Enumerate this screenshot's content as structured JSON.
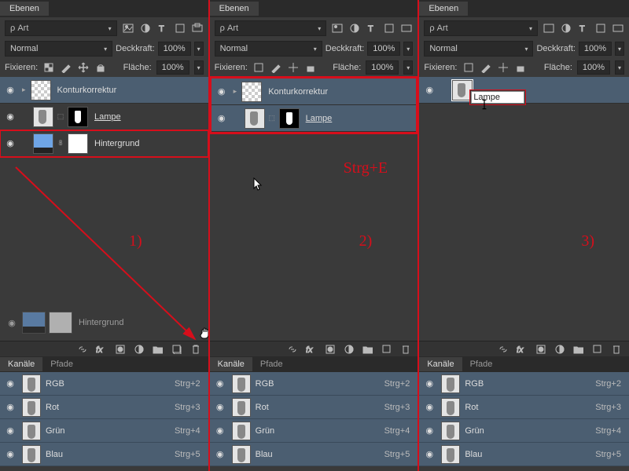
{
  "panel_title": "Ebenen",
  "filter_label": "Art",
  "blend_mode": "Normal",
  "opacity_label": "Deckkraft:",
  "opacity_value": "100%",
  "fix_label": "Fixieren:",
  "fill_label": "Fläche:",
  "fill_value": "100%",
  "layers": {
    "kontur": "Konturkorrektur",
    "lampe": "Lampe",
    "lampe_u": "Lampe ",
    "hintergrund": "Hintergrund"
  },
  "rename_value": "Lampe",
  "channels_tab": "Kanäle",
  "paths_tab": "Pfade",
  "channels": [
    {
      "name": "RGB",
      "shortcut": "Strg+2"
    },
    {
      "name": "Rot",
      "shortcut": "Strg+3"
    },
    {
      "name": "Grün",
      "shortcut": "Strg+4"
    },
    {
      "name": "Blau",
      "shortcut": "Strg+5"
    }
  ],
  "ann": {
    "one": "1)",
    "two": "2)",
    "three": "3)",
    "merge": "Strg+E"
  }
}
